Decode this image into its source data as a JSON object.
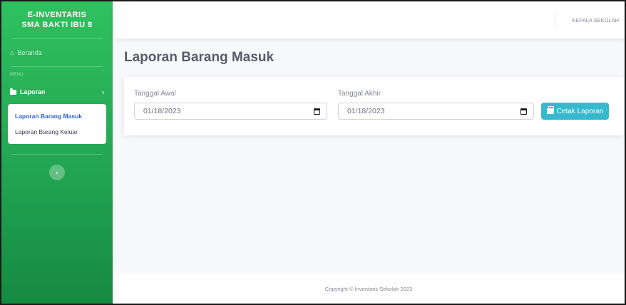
{
  "brand": {
    "line1": "E-INVENTARIS",
    "line2": "SMA BAKTI IBU 8"
  },
  "sidebar": {
    "home_label": "Beranda",
    "heading": "MENU",
    "laporan_label": "Laporan",
    "submenu": [
      "Laporan Barang Masuk",
      "Laporan Barang Keluar"
    ]
  },
  "topbar": {
    "user": "KEPALA SEKOLAH"
  },
  "page": {
    "title": "Laporan Barang Masuk"
  },
  "form": {
    "start_label": "Tanggal Awal",
    "start_value": "01/18/2023",
    "end_label": "Tanggal Akhir",
    "end_value": "01/18/2023",
    "print_button": "Cetak Laporan"
  },
  "footer": {
    "text": "Copyright © Inventaris Sekolah 2023"
  },
  "colors": {
    "sidebar": "#22a552",
    "button": "#36b9cc",
    "active_link": "#2a63c9"
  }
}
